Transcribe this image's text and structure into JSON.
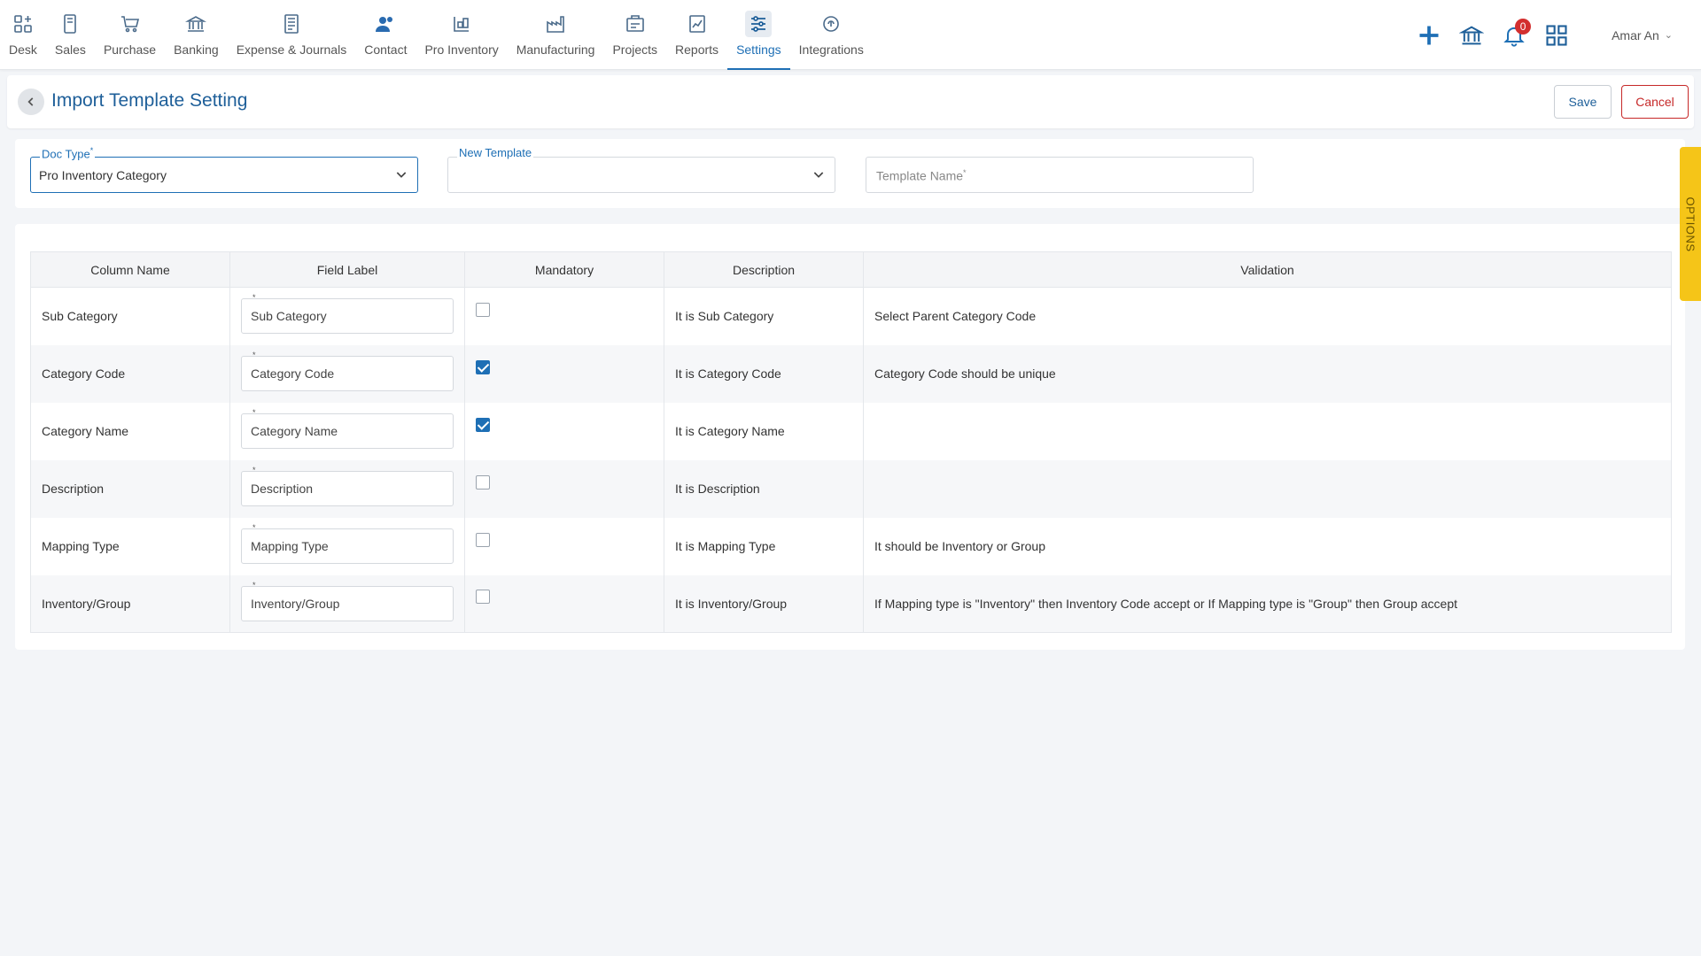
{
  "nav": [
    {
      "key": "desk",
      "label": "Desk",
      "icon": "desk-icon"
    },
    {
      "key": "sales",
      "label": "Sales",
      "icon": "sales-icon"
    },
    {
      "key": "purchase",
      "label": "Purchase",
      "icon": "cart-icon"
    },
    {
      "key": "banking",
      "label": "Banking",
      "icon": "bank-icon"
    },
    {
      "key": "expense",
      "label": "Expense & Journals",
      "icon": "journal-icon"
    },
    {
      "key": "contact",
      "label": "Contact",
      "icon": "contact-icon"
    },
    {
      "key": "pro-inventory",
      "label": "Pro Inventory",
      "icon": "inventory-icon"
    },
    {
      "key": "manufacturing",
      "label": "Manufacturing",
      "icon": "factory-icon"
    },
    {
      "key": "projects",
      "label": "Projects",
      "icon": "projects-icon"
    },
    {
      "key": "reports",
      "label": "Reports",
      "icon": "reports-icon"
    },
    {
      "key": "settings",
      "label": "Settings",
      "icon": "settings-icon",
      "active": true
    },
    {
      "key": "integrations",
      "label": "Integrations",
      "icon": "integrations-icon"
    }
  ],
  "toolbar": {
    "notification_count": "0",
    "user_name": "Amar An"
  },
  "header": {
    "title": "Import Template Setting",
    "save_label": "Save",
    "cancel_label": "Cancel"
  },
  "filters": {
    "doc_type_label": "Doc Type",
    "doc_type_required": "*",
    "doc_type_value": "Pro Inventory Category",
    "new_template_label": "New Template",
    "new_template_value": "",
    "template_name_placeholder": "Template Name",
    "template_name_required": "*"
  },
  "table": {
    "headers": [
      "Column Name",
      "Field Label",
      "Mandatory",
      "Description",
      "Validation"
    ],
    "rows": [
      {
        "column": "Sub Category",
        "label": "Sub Category",
        "mandatory": false,
        "description": "It is Sub Category",
        "validation": "Select Parent Category Code"
      },
      {
        "column": "Category Code",
        "label": "Category Code",
        "mandatory": true,
        "description": "It is Category Code",
        "validation": "Category Code should be unique"
      },
      {
        "column": "Category Name",
        "label": "Category Name",
        "mandatory": true,
        "description": "It is Category Name",
        "validation": ""
      },
      {
        "column": "Description",
        "label": "Description",
        "mandatory": false,
        "description": "It is Description",
        "validation": ""
      },
      {
        "column": "Mapping Type",
        "label": "Mapping Type",
        "mandatory": false,
        "description": "It is Mapping Type",
        "validation": "It should be Inventory or Group"
      },
      {
        "column": "Inventory/Group",
        "label": "Inventory/Group",
        "mandatory": false,
        "description": "It is Inventory/Group",
        "validation": "If Mapping type is \"Inventory\" then Inventory Code accept or If Mapping type is \"Group\" then Group accept"
      }
    ]
  },
  "options_tab_label": "OPTIONS",
  "colors": {
    "accent": "#1e6fb5",
    "title": "#1e5f99",
    "cancel": "#c62828",
    "options": "#f5c518",
    "badge": "#d32f2f"
  }
}
